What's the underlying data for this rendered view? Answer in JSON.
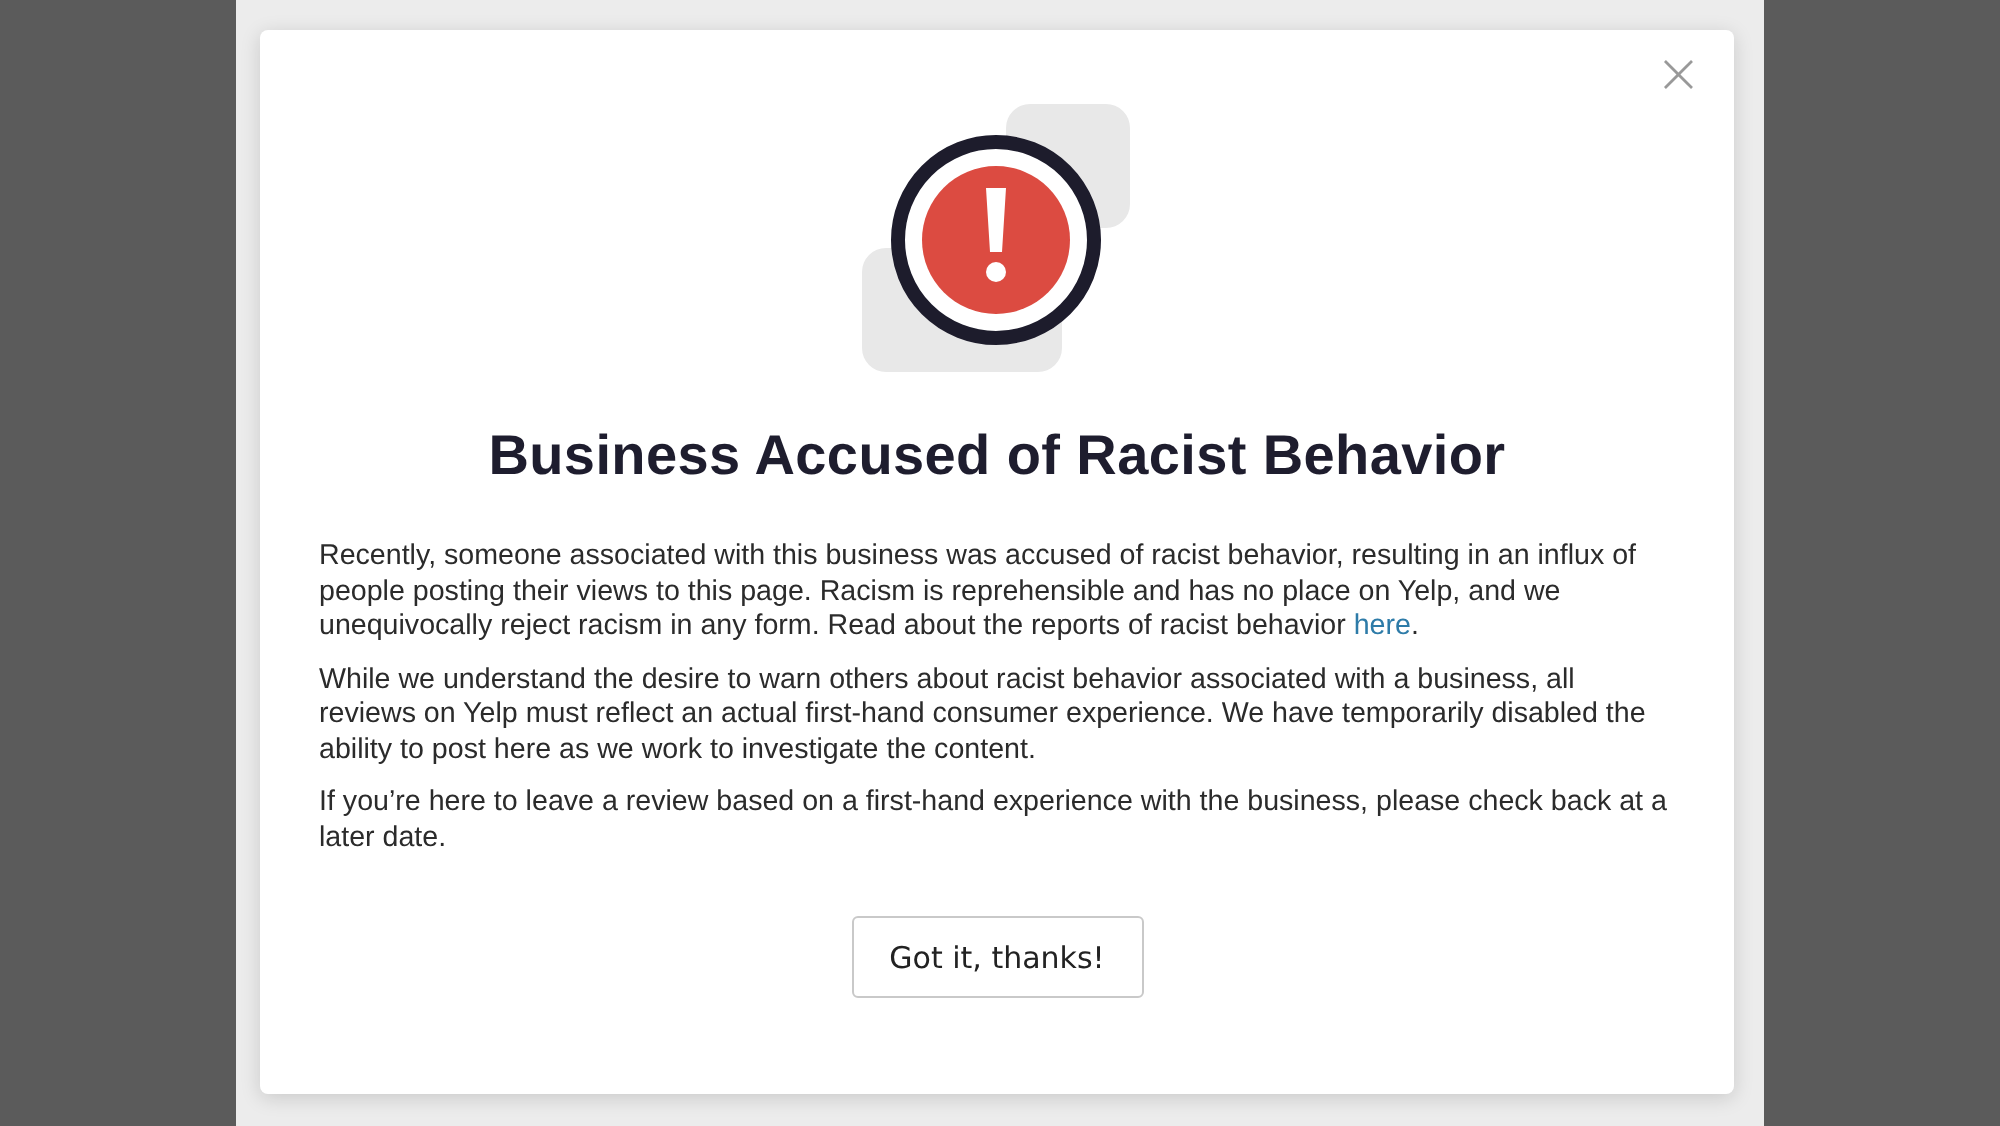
{
  "dialog": {
    "close": "×",
    "title": "Business Accused of Racist Behavior",
    "paragraphs": [
      {
        "text": "Recently, someone associated with this business was accused of racist behavior, resulting in an influx of people posting their views to this page. Racism is reprehensible and has no place on Yelp, and we unequivocally reject racism in any form. Read about the reports of racist behavior ",
        "link": "here",
        "after": "."
      },
      {
        "text": "While we understand the desire to warn others about racist behavior associated with a business, all reviews on Yelp must reflect an actual first-hand consumer experience. We have temporarily disabled the ability to post here as we work to investigate the content."
      },
      {
        "text": "If you’re here to leave a review based on a first-hand experience with the business, please check back at a later date."
      }
    ],
    "button": "Got it, thanks!"
  }
}
